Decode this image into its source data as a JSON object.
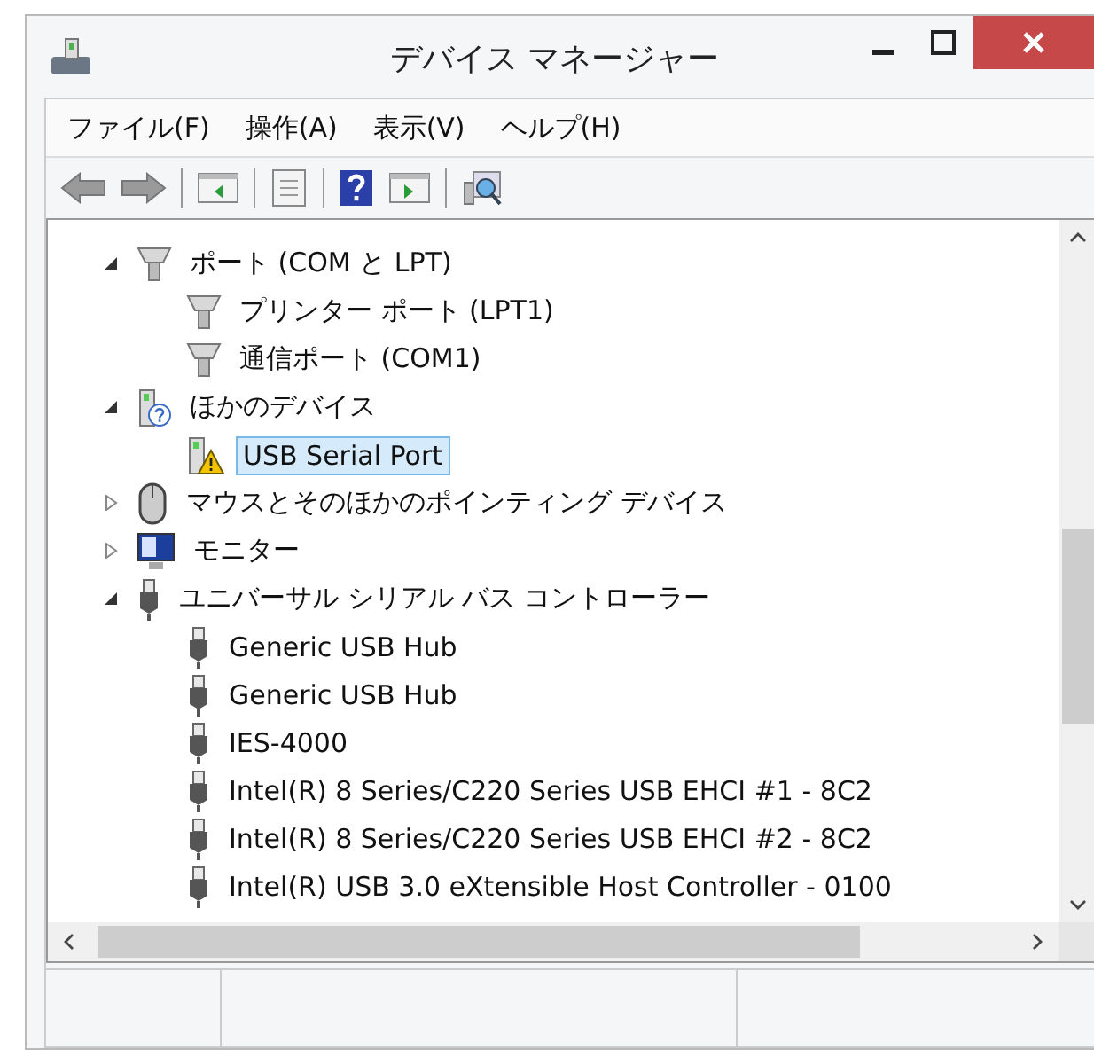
{
  "window": {
    "title": "デバイス マネージャー"
  },
  "menu": [
    "ファイル(F)",
    "操作(A)",
    "表示(V)",
    "ヘルプ(H)"
  ],
  "tree": [
    {
      "label": "ポート (COM と LPT)",
      "kind": "port",
      "expanded": true,
      "selected": false,
      "children": [
        {
          "label": "プリンター ポート (LPT1)",
          "kind": "port",
          "selected": false
        },
        {
          "label": "通信ポート (COM1)",
          "kind": "port",
          "selected": false
        }
      ]
    },
    {
      "label": "ほかのデバイス",
      "kind": "unknown",
      "expanded": true,
      "selected": false,
      "children": [
        {
          "label": "USB Serial Port",
          "kind": "warning",
          "selected": true
        }
      ]
    },
    {
      "label": "マウスとそのほかのポインティング デバイス",
      "kind": "mouse",
      "expanded": false,
      "selected": false
    },
    {
      "label": "モニター",
      "kind": "monitor",
      "expanded": false,
      "selected": false
    },
    {
      "label": "ユニバーサル シリアル バス コントローラー",
      "kind": "usb",
      "expanded": true,
      "selected": false,
      "children": [
        {
          "label": "Generic USB Hub",
          "kind": "usb",
          "selected": false
        },
        {
          "label": "Generic USB Hub",
          "kind": "usb",
          "selected": false
        },
        {
          "label": "IES-4000",
          "kind": "usb",
          "selected": false
        },
        {
          "label": "Intel(R) 8 Series/C220 Series USB EHCI #1 - 8C2",
          "kind": "usb",
          "selected": false
        },
        {
          "label": "Intel(R) 8 Series/C220 Series USB EHCI #2 - 8C2",
          "kind": "usb",
          "selected": false
        },
        {
          "label": "Intel(R) USB 3.0 eXtensible Host Controller - 0100",
          "kind": "usb",
          "selected": false
        }
      ]
    }
  ]
}
